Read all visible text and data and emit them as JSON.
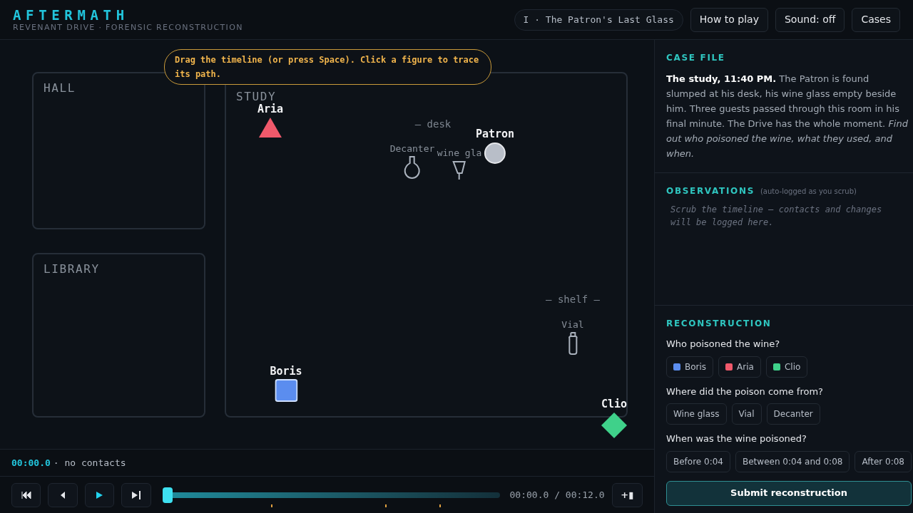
{
  "header": {
    "title": "AFTERMATH",
    "subtitle": "REVENANT DRIVE · FORENSIC RECONSTRUCTION",
    "case_chip": "I · The Patron's Last Glass",
    "buttons": [
      "How to play",
      "Sound: off",
      "Cases"
    ]
  },
  "hint": "Drag the timeline (or press Space). Click a figure to trace its path.",
  "rooms": [
    {
      "label": "HALL"
    },
    {
      "label": "LIBRARY"
    },
    {
      "label": "STUDY"
    }
  ],
  "zones": [
    "– desk",
    "– shelf –"
  ],
  "objects": [
    {
      "label": "Decanter",
      "kind": "decanter"
    },
    {
      "label": "wine gla",
      "kind": "glass"
    },
    {
      "label": "Vial",
      "kind": "vial"
    }
  ],
  "figures": [
    {
      "name": "Aria",
      "kind": "triangle",
      "color": "#f0596b"
    },
    {
      "name": "Patron",
      "kind": "circle",
      "color": "#b8bec8"
    },
    {
      "name": "Boris",
      "kind": "square",
      "color": "#5b8def"
    },
    {
      "name": "Clio",
      "kind": "diamond",
      "color": "#3fd18a"
    }
  ],
  "log": {
    "time": "00:00.0",
    "text": "· no contacts"
  },
  "player": {
    "buttons": [
      {
        "kind": "first"
      },
      {
        "kind": "back"
      },
      {
        "kind": "play"
      },
      {
        "kind": "last"
      }
    ],
    "level": 0,
    "time": "00:00.0 / 00:12.0",
    "extra": "+▮"
  },
  "case_file": {
    "heading": "CASE FILE",
    "text": "**The study, 11:40 PM.** The Patron is found slumped at his desk, his wine glass empty beside him. Three guests passed through this room in his final minute. The Drive has the whole moment. *Find out who poisoned the wine, what they used, and when.*"
  },
  "observations": {
    "heading": "OBSERVATIONS",
    "note": "(auto-logged as you scrub)",
    "empty_message": "Scrub the timeline — contacts and changes will be logged here."
  },
  "reconstruction": {
    "heading": "RECONSTRUCTION",
    "questions": [
      {
        "text": "Who poisoned the wine?",
        "options": [
          {
            "label": "Boris",
            "color": "#5b8def",
            "selected": false
          },
          {
            "label": "Aria",
            "color": "#f0596b",
            "selected": false
          },
          {
            "label": "Clio",
            "color": "#3fd18a",
            "selected": false
          }
        ]
      },
      {
        "text": "Where did the poison come from?",
        "options": [
          {
            "label": "Wine glass",
            "selected": false
          },
          {
            "label": "Vial",
            "selected": false
          },
          {
            "label": "Decanter",
            "selected": false
          }
        ]
      },
      {
        "text": "When was the wine poisoned?",
        "options": [
          {
            "label": "Before 0:04",
            "selected": false
          },
          {
            "label": "Between 0:04 and 0:08",
            "selected": false
          },
          {
            "label": "After 0:08",
            "selected": false
          }
        ]
      }
    ],
    "submit": "Submit reconstruction"
  }
}
